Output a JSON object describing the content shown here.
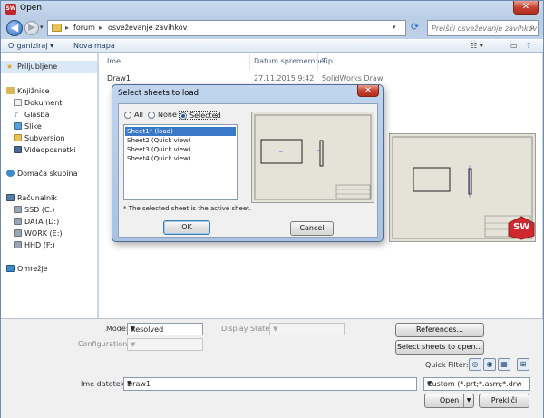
{
  "window": {
    "title": "Open"
  },
  "address": {
    "path": [
      "forum",
      "osveževanje zavihkov"
    ],
    "search_placeholder": "Preišči osveževanje zavihkov"
  },
  "toolbar": {
    "organize": "Organiziraj ▾",
    "new_folder": "Nova mapa"
  },
  "nav": {
    "favorites": "Priljubljene",
    "libraries": "Knjižnice",
    "lib_items": [
      "Dokumenti",
      "Glasba",
      "Slike",
      "Subversion",
      "Videoposnetki"
    ],
    "homegroup": "Domača skupina",
    "computer": "Računalnik",
    "drives": [
      "SSD (C:)",
      "DATA (D:)",
      "WORK (E:)",
      "HHD (F:)"
    ],
    "network": "Omrežje"
  },
  "columns": {
    "name": "Ime",
    "date": "Datum spremembe",
    "type": "Tip"
  },
  "files": [
    {
      "name": "Draw1",
      "date": "27.11.2015 9:42",
      "type": "SolidWorks Drawi"
    }
  ],
  "bottom": {
    "mode_label": "Mode:",
    "mode_value": "Resolved",
    "display_states_label": "Display States:",
    "configurations_label": "Configurations:",
    "references_button": "References...",
    "select_sheets_button": "Select sheets to open...",
    "quick_filter_label": "Quick Filter:",
    "filename_label": "Ime datoteke:",
    "filename_value": "Draw1",
    "filetype_value": "Custom (*.prt;*.asm;*.drw;*.sldp",
    "open_button": "Open",
    "cancel_button": "Prekliči",
    "sw_logo": "SW"
  },
  "dialog": {
    "title": "Select sheets to load",
    "radios": [
      "All",
      "None",
      "Selected"
    ],
    "selected_radio": "Selected",
    "sheets": [
      "Sheet1* (load)",
      "Sheet2 (Quick view)",
      "Sheet3 (Quick view)",
      "Sheet4 (Quick view)"
    ],
    "selected_sheet": "Sheet1* (load)",
    "note": "* The selected sheet is the active sheet.",
    "ok_button": "OK",
    "cancel_button": "Cancel"
  },
  "colors": {
    "accent": "#3a78c8",
    "close_red": "#c74333",
    "solidworks_red": "#d0282e"
  }
}
